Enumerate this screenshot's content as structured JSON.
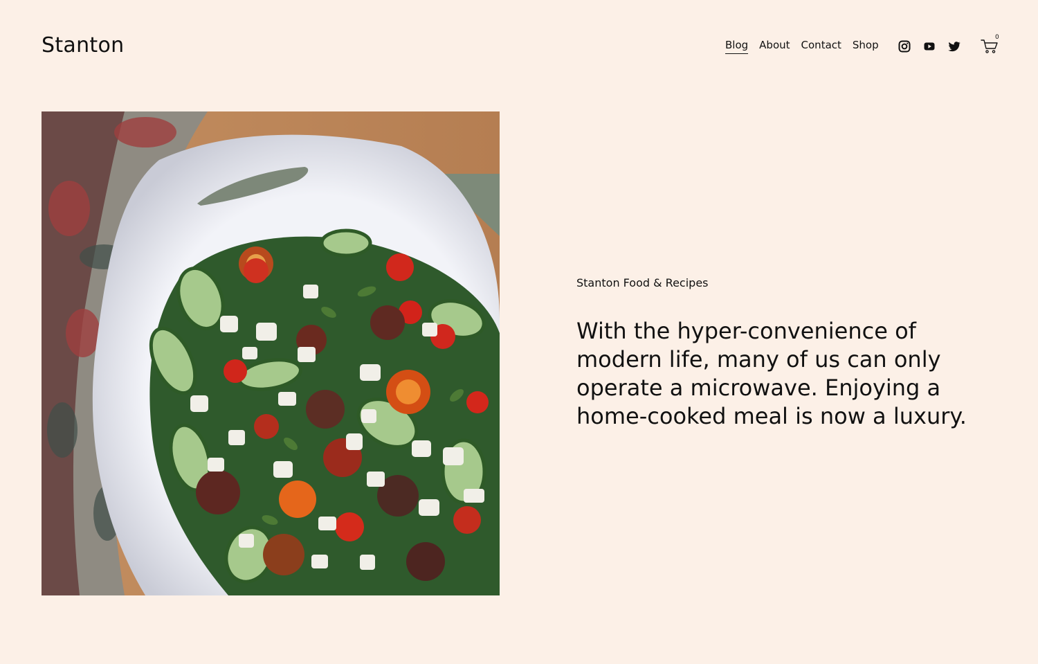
{
  "site": {
    "logo": "Stanton"
  },
  "nav": {
    "items": [
      {
        "label": "Blog",
        "active": true
      },
      {
        "label": "About",
        "active": false
      },
      {
        "label": "Contact",
        "active": false
      },
      {
        "label": "Shop",
        "active": false
      }
    ]
  },
  "social": {
    "icons": [
      "instagram-icon",
      "youtube-icon",
      "twitter-icon"
    ]
  },
  "cart": {
    "icon": "cart-icon",
    "count": "0"
  },
  "hero": {
    "image_description": "",
    "eyebrow": "Stanton Food & Recipes",
    "headline": "With the hyper-convenience of modern life, many of us can only operate a microwave. Enjoying a home-cooked meal is now a luxury."
  },
  "colors": {
    "background": "#fcf0e7",
    "text": "#111111"
  }
}
